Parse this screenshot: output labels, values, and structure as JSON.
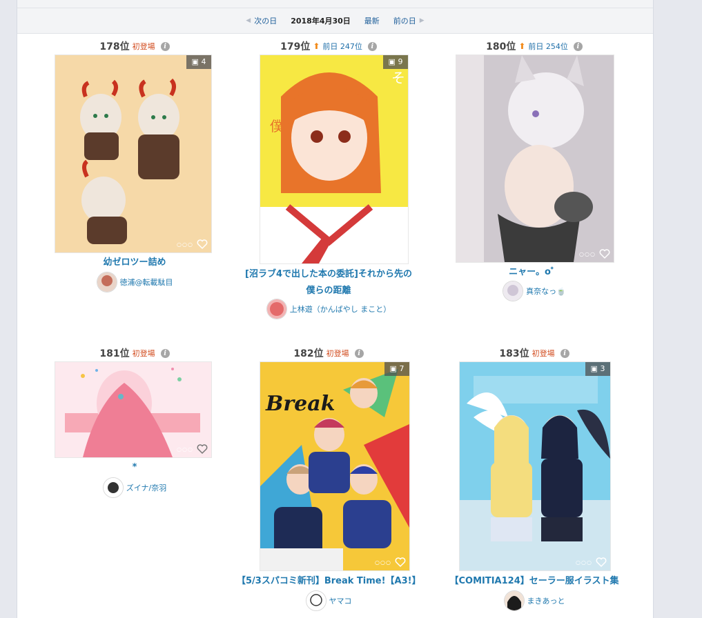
{
  "nav": {
    "next_day": "次の日",
    "date": "2018年4月30日",
    "latest": "最新",
    "prev_day": "前の日"
  },
  "items": [
    {
      "rank": "178位",
      "first": "初登場",
      "prev": "",
      "pages": "4",
      "title": "幼ゼロツー詰め",
      "title2": "",
      "author": "徳浦@転載駄目",
      "colors": {
        "bg": "#f6d9a8",
        "fg": "#5b3b2b",
        "accent": "#c8321f"
      }
    },
    {
      "rank": "179位",
      "first": "",
      "prev": "前日 247位",
      "pages": "9",
      "title": "[沼ラブ4で出した本の委託]それから先の",
      "title2": "僕らの距離",
      "author": "上林遊（かんばやし まこと）",
      "colors": {
        "bg": "#f7e843",
        "fg": "#e8742a",
        "accent": "#d43a3a"
      }
    },
    {
      "rank": "180位",
      "first": "",
      "prev": "前日 254位",
      "pages": "",
      "title": "ニャー。o゜",
      "title2": "",
      "author": "真奈なっ🍵",
      "colors": {
        "bg": "#cfc9cf",
        "fg": "#5a5560",
        "accent": "#f0e6ea"
      }
    },
    {
      "rank": "181位",
      "first": "初登場",
      "prev": "",
      "pages": "",
      "title": "*",
      "title2": "",
      "author": "ズイナ/奈羽",
      "colors": {
        "bg": "#fde9ee",
        "fg": "#ef7e95",
        "accent": "#f7a9b6"
      }
    },
    {
      "rank": "182位",
      "first": "初登場",
      "prev": "",
      "pages": "7",
      "title": "【5/3スパコミ新刊】Break Time!【A3!】",
      "title2": "",
      "author": "ヤマコ",
      "colors": {
        "bg": "#f6c839",
        "fg": "#2b3f8f",
        "accent": "#e23b3b"
      }
    },
    {
      "rank": "183位",
      "first": "初登場",
      "prev": "",
      "pages": "3",
      "title": "【COMITIA124】セーラー服イラスト集",
      "title2": "",
      "author": "まきあっと",
      "colors": {
        "bg": "#7fd0ec",
        "fg": "#1c2440",
        "accent": "#f4dd7e"
      }
    }
  ]
}
